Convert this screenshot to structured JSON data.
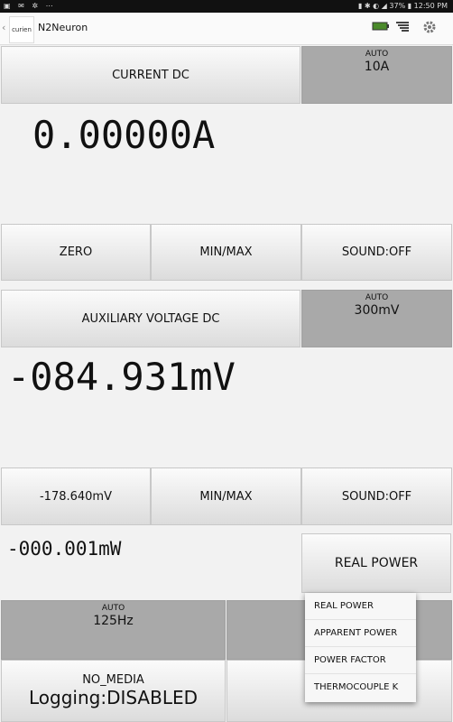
{
  "status_bar": {
    "battery": "37%",
    "time": "12:50 PM"
  },
  "app_bar": {
    "back_glyph": "‹",
    "logo": "curien",
    "title": "N2Neuron"
  },
  "current": {
    "mode_label": "CURRENT DC",
    "range_auto": "AUTO",
    "range_value": "10A",
    "reading": "0.00000A",
    "buttons": {
      "zero": "ZERO",
      "minmax": "MIN/MAX",
      "sound": "SOUND:OFF"
    }
  },
  "voltage": {
    "mode_label": "AUXILIARY VOLTAGE DC",
    "range_auto": "AUTO",
    "range_value": "300mV",
    "reading": "-084.931mV",
    "buttons": {
      "value": "-178.640mV",
      "minmax": "MIN/MAX",
      "sound": "SOUND:OFF"
    }
  },
  "power": {
    "reading": "-000.001mW",
    "mode_selected": "REAL POWER",
    "options": [
      "REAL POWER",
      "APPARENT POWER",
      "POWER FACTOR",
      "THERMOCOUPLE K"
    ]
  },
  "frequency": {
    "auto": "AUTO",
    "value": "125Hz"
  },
  "logging": {
    "media": "NO_MEDIA",
    "status": "Logging:DISABLED"
  }
}
